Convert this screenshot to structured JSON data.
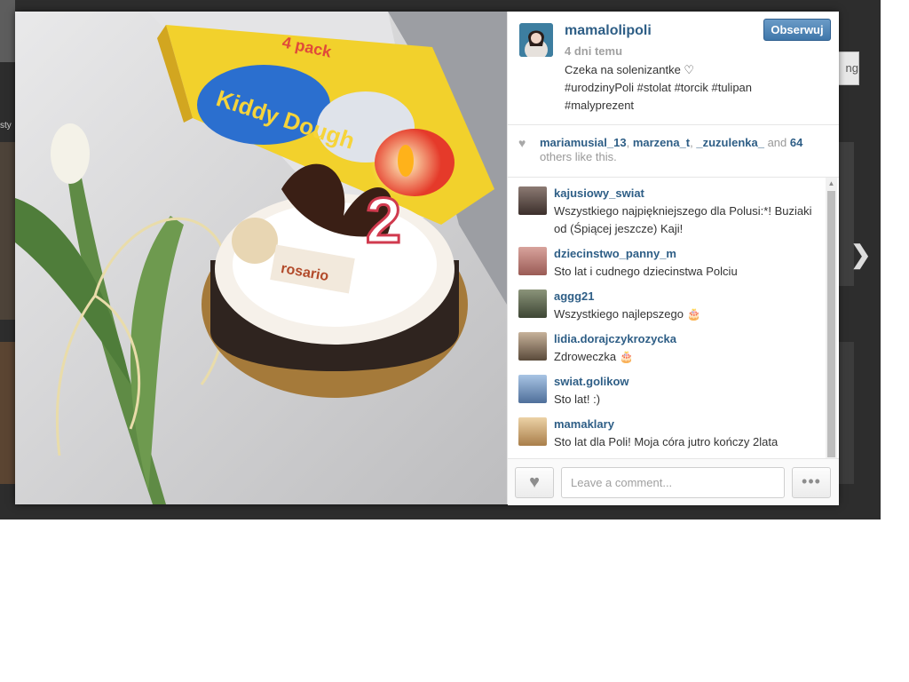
{
  "backdrop": {
    "button_fragment": "ng",
    "label_fragment": "sty",
    "next_arrow": "❯"
  },
  "post": {
    "author": "mamalolipoli",
    "time": "4 dni temu",
    "follow_label": "Obserwuj",
    "caption_line1": "Czeka na solenizantke ♡",
    "caption_tags_line2": "#urodzinyPoli #stolat #torcik #tulipan",
    "caption_tags_line3": "#malyprezent"
  },
  "likes": {
    "users": [
      "mariamusial_13",
      "marzena_t",
      "_zuzulenka_"
    ],
    "and_text": "and",
    "others_count": "64",
    "others_text": "others like this."
  },
  "comments": [
    {
      "user": "kajusiowy_swiat",
      "text": "Wszystkiego najpiękniejszego dla Polusi:*! Buziaki od (Śpiącej jeszcze) Kaji!",
      "avatar_color": "#5b4a44"
    },
    {
      "user": "dziecinstwo_panny_m",
      "text": "Sto lat i cudnego dziecinstwa Polciu",
      "avatar_color": "#c47c7a"
    },
    {
      "user": "aggg21",
      "text": "Wszystkiego najlepszego 🎂",
      "avatar_color": "#55604a"
    },
    {
      "user": "lidia.dorajczykrozycka",
      "text": "Zdroweczka 🎂",
      "avatar_color": "#7a6a5a"
    },
    {
      "user": "swiat.golikow",
      "text": "Sto lat! :)",
      "avatar_color": "#6f8fb8"
    },
    {
      "user": "mamaklary",
      "text": "Sto lat dla Poli! Moja córa jutro kończy 2lata",
      "avatar_color": "#c9a06b"
    }
  ],
  "comment_box": {
    "placeholder": "Leave a comment...",
    "more_label": "•••"
  },
  "photo": {
    "box_brand": "Kiddy Dough",
    "box_pack": "4 pack",
    "cake_brand": "rosario",
    "candle_number": "2"
  },
  "colors": {
    "link": "#2e5e86",
    "follow_button": "#3f77aa",
    "muted": "#a1a1a1"
  }
}
